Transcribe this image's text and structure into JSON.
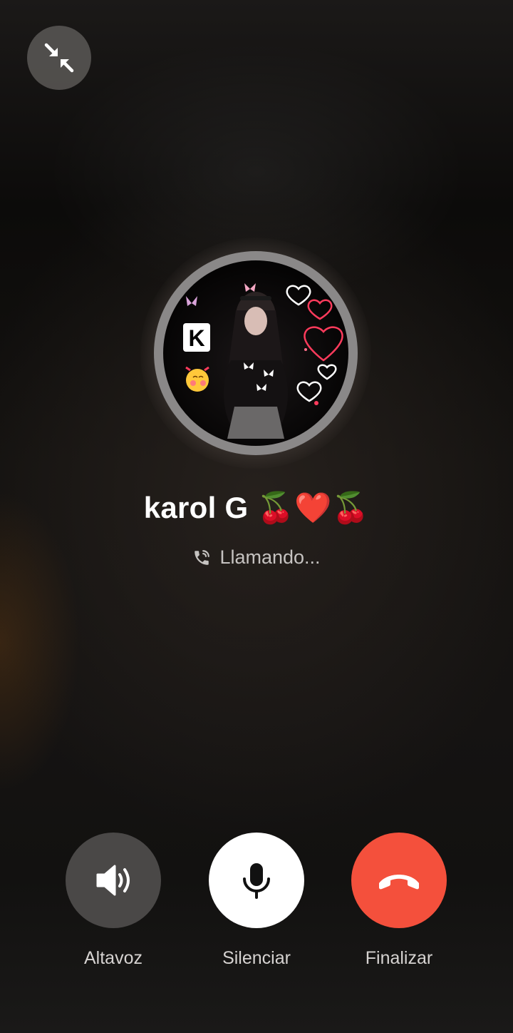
{
  "call": {
    "contact_name": "karol G 🍒❤️🍒",
    "status": "Llamando..."
  },
  "avatar": {
    "letter": "K"
  },
  "controls": {
    "speaker_label": "Altavoz",
    "mute_label": "Silenciar",
    "end_label": "Finalizar"
  },
  "icons": {
    "minimize": "minimize-arrows-icon",
    "status": "phone-calling-icon",
    "speaker": "speaker-icon",
    "mute": "microphone-icon",
    "end": "end-call-icon"
  },
  "colors": {
    "end_call": "#f4503c",
    "mute_bg": "#ffffff",
    "speaker_bg": "#4a4847"
  }
}
